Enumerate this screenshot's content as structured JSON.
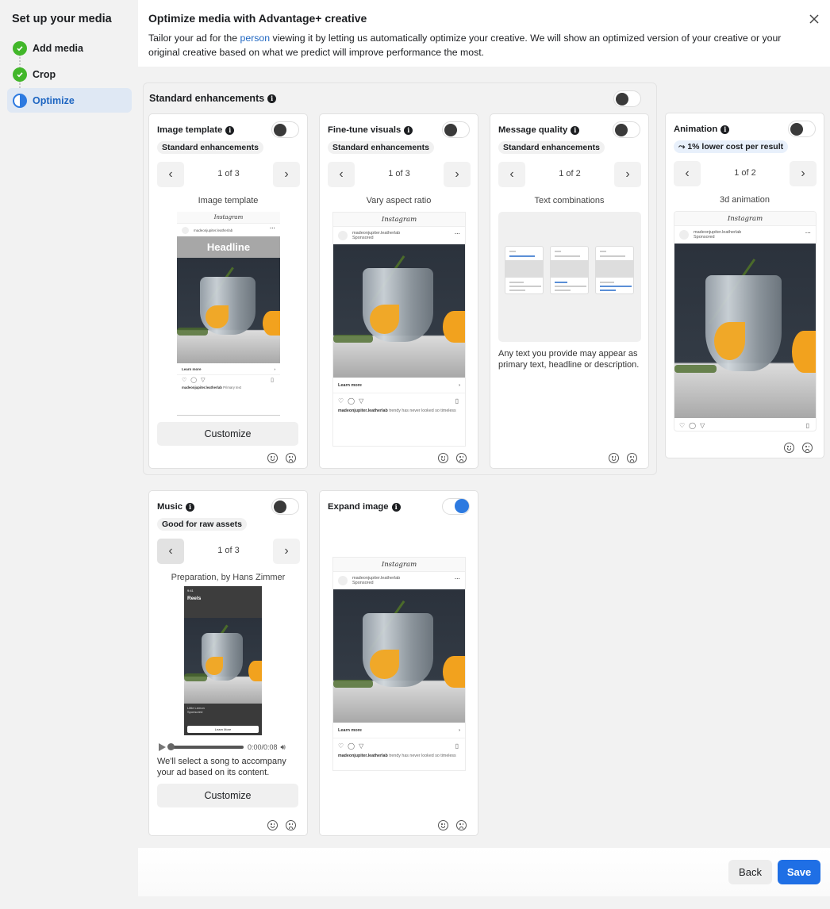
{
  "sidebar": {
    "title": "Set up your media",
    "steps": [
      {
        "label": "Add media",
        "state": "done"
      },
      {
        "label": "Crop",
        "state": "done"
      },
      {
        "label": "Optimize",
        "state": "active"
      }
    ]
  },
  "header": {
    "title": "Optimize media with Advantage+ creative",
    "desc_before": "Tailor your ad for the ",
    "desc_link": "person",
    "desc_after": " viewing it by letting us automatically optimize your creative. We will show an optimized version of your creative or your original creative based on what we predict will improve performance the most."
  },
  "standard_group": {
    "title": "Standard enhancements",
    "enabled": false
  },
  "cards": [
    {
      "title": "Image template",
      "chip": "Standard enhancements",
      "page": "1 of 3",
      "variant": "Image template",
      "enabled": false,
      "customize": "Customize",
      "headline": "Headline"
    },
    {
      "title": "Fine-tune visuals",
      "chip": "Standard enhancements",
      "page": "1 of 3",
      "variant": "Vary aspect ratio",
      "enabled": false
    },
    {
      "title": "Message quality",
      "chip": "Standard enhancements",
      "page": "1 of 2",
      "variant": "Text combinations",
      "enabled": false,
      "description": "Any text you provide may appear as primary text, headline or description."
    },
    {
      "title": "Animation",
      "chip": "1% lower cost per result",
      "page": "1 of 2",
      "variant": "3d animation",
      "enabled": false
    },
    {
      "title": "Music",
      "chip": "Good for raw assets",
      "page": "1 of 3",
      "variant": "Preparation, by Hans Zimmer",
      "enabled": false,
      "time": "0:00/0:08",
      "description": "We'll select a song to accompany your ad based on its content.",
      "customize": "Customize"
    },
    {
      "title": "Expand image",
      "enabled": true
    }
  ],
  "ig_preview": {
    "brand": "Instagram",
    "account": "madeonjupiter.leatherlab",
    "sponsored": "Sponsored",
    "cta": "Learn more",
    "caption": "trendy has never looked so timeless",
    "caption_short": "Primary text"
  },
  "reel_preview": {
    "time": "9:41",
    "title": "Reels",
    "account": "Little Lemon",
    "sponsored": "Sponsored",
    "cta": "Learn More"
  },
  "footer": {
    "back": "Back",
    "save": "Save"
  },
  "colors": {
    "primary": "#1f6fe5",
    "success": "#42b72a",
    "link": "#1d65c1"
  }
}
